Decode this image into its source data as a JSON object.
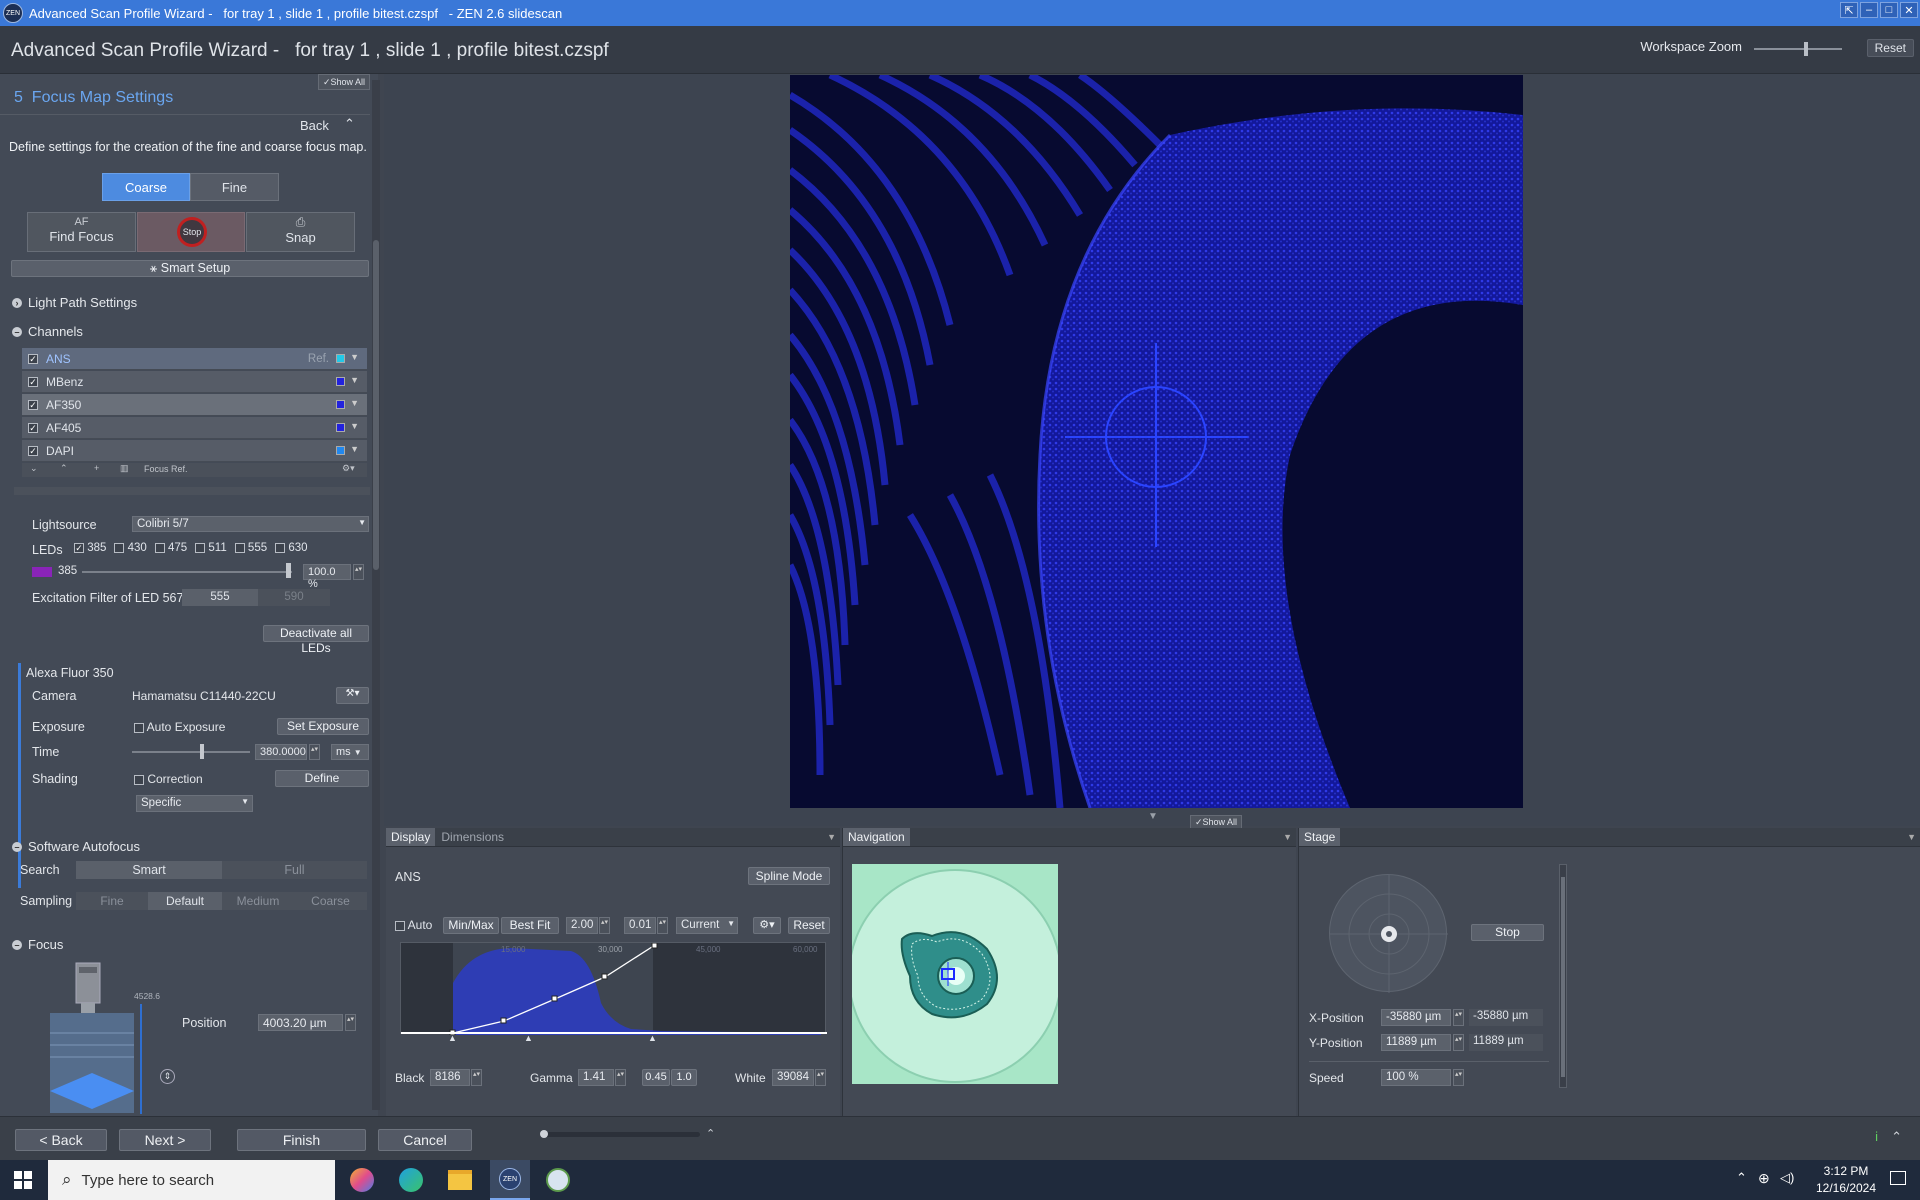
{
  "window": {
    "title": "Advanced Scan Profile Wizard -   for tray 1 , slide 1 , profile bitest.czspf   - ZEN 2.6 slidescan",
    "logo_text": "ZEN",
    "controls": [
      "⇱",
      "–",
      "□",
      "✕"
    ]
  },
  "header": {
    "title": "Advanced Scan Profile Wizard -   for tray 1 , slide 1 , profile bitest.czspf",
    "workspace_zoom_label": "Workspace Zoom",
    "reset_label": "Reset"
  },
  "left": {
    "show_all": "✓Show All",
    "step_title": "5  Focus Map Settings",
    "back_label": "Back",
    "description": "Define settings for the creation of the fine and coarse focus map.",
    "tabs": [
      "Coarse",
      "Fine"
    ],
    "actions": {
      "af": "AF",
      "find_focus": "Find Focus",
      "stop": "Stop",
      "snap": "Snap"
    },
    "smart_setup": "Smart Setup",
    "light_path": "Light Path Settings",
    "channels_title": "Channels",
    "channels": [
      {
        "name": "ANS",
        "ref": "Ref.",
        "color": "#22c8e8"
      },
      {
        "name": "MBenz",
        "ref": "",
        "color": "#2222dd"
      },
      {
        "name": "AF350",
        "ref": "",
        "color": "#2222dd"
      },
      {
        "name": "AF405",
        "ref": "",
        "color": "#2222dd"
      },
      {
        "name": "DAPI",
        "ref": "",
        "color": "#2288ee"
      }
    ],
    "channel_toolbar": {
      "focus_ref": "Focus Ref."
    },
    "lightsource_label": "Lightsource",
    "lightsource_value": "Colibri 5/7",
    "leds_label": "LEDs",
    "leds": [
      {
        "label": "385",
        "checked": true
      },
      {
        "label": "430",
        "checked": false
      },
      {
        "label": "475",
        "checked": false
      },
      {
        "label": "511",
        "checked": false
      },
      {
        "label": "555",
        "checked": false
      },
      {
        "label": "630",
        "checked": false
      }
    ],
    "led_intensity_label": "385",
    "led_intensity_value": "100.0 %",
    "led_intensity_fraction": 1.0,
    "excitation_label": "Excitation Filter of LED 567",
    "excitation_values": [
      "555",
      "590"
    ],
    "deactivate_leds": "Deactivate all LEDs",
    "dye_name": "Alexa Fluor 350",
    "camera_label": "Camera",
    "camera_value": "Hamamatsu C11440-22CU",
    "exposure_label": "Exposure",
    "auto_exposure": "Auto Exposure",
    "set_exposure": "Set Exposure",
    "time_label": "Time",
    "time_value": "380.0000",
    "time_unit": "ms",
    "shading_label": "Shading",
    "correction_label": "Correction",
    "define_label": "Define",
    "specific_value": "Specific",
    "software_af_title": "Software Autofocus",
    "search_label": "Search",
    "search_options": [
      "Smart",
      "Full"
    ],
    "sampling_label": "Sampling",
    "sampling_options": [
      "Fine",
      "Default",
      "Medium",
      "Coarse"
    ],
    "focus_title": "Focus",
    "focus_top_value": "4528.6",
    "position_label": "Position",
    "position_value": "4003.20 µm"
  },
  "viewer": {
    "show_all": "✓Show All"
  },
  "display": {
    "tabs": [
      "Display",
      "Dimensions"
    ],
    "channel_name": "ANS",
    "spline_mode": "Spline Mode",
    "auto_label": "Auto",
    "minmax": "Min/Max",
    "bestfit": "Best Fit",
    "val1": "2.00",
    "val2": "0.01",
    "current": "Current",
    "reset": "Reset",
    "hist_ticks": [
      "15,000",
      "30,000",
      "45,000",
      "60,000"
    ],
    "black_label": "Black",
    "black_value": "8186",
    "gamma_label": "Gamma",
    "gamma_value": "1.41",
    "gamma_a": "0.45",
    "gamma_b": "1.0",
    "white_label": "White",
    "white_value": "39084"
  },
  "navigation": {
    "tab": "Navigation"
  },
  "stage": {
    "tab": "Stage",
    "stop": "Stop",
    "x_label": "X-Position",
    "x_value": "-35880 µm",
    "x_readout": "-35880 µm",
    "y_label": "Y-Position",
    "y_value": "11889 µm",
    "y_readout": "11889 µm",
    "speed_label": "Speed",
    "speed_value": "100 %"
  },
  "footer": {
    "back": "< Back",
    "next": "Next >",
    "finish": "Finish",
    "cancel": "Cancel"
  },
  "taskbar": {
    "search_placeholder": "Type here to search",
    "time": "3:12 PM",
    "date": "12/16/2024"
  }
}
